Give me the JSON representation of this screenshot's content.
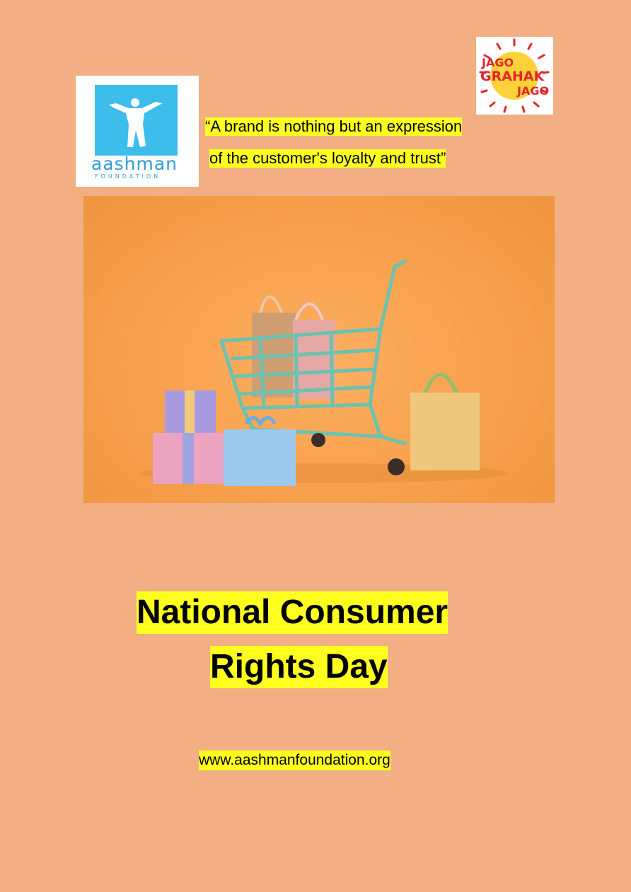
{
  "logos": {
    "aashman": {
      "name": "aashman",
      "subtitle": "FOUNDATION"
    },
    "jago_grahak": {
      "line1": "JAGO",
      "line2": "GRAHAK",
      "line3": "JAGO"
    }
  },
  "quote": {
    "line1": "“A brand is nothing but an expression",
    "line2": " of the customer's loyalty and trust”"
  },
  "photo": {
    "subject": "shopping-cart-with-gifts-and-bags"
  },
  "title": {
    "line1": "National Consumer",
    "line2": " Rights Day"
  },
  "website": "www.aashmanfoundation.org",
  "colors": {
    "page_background": "#F2AF83",
    "highlight": "#FFFF1F",
    "aashman_blue": "#3DBDEB",
    "jago_red": "#E3262B"
  }
}
